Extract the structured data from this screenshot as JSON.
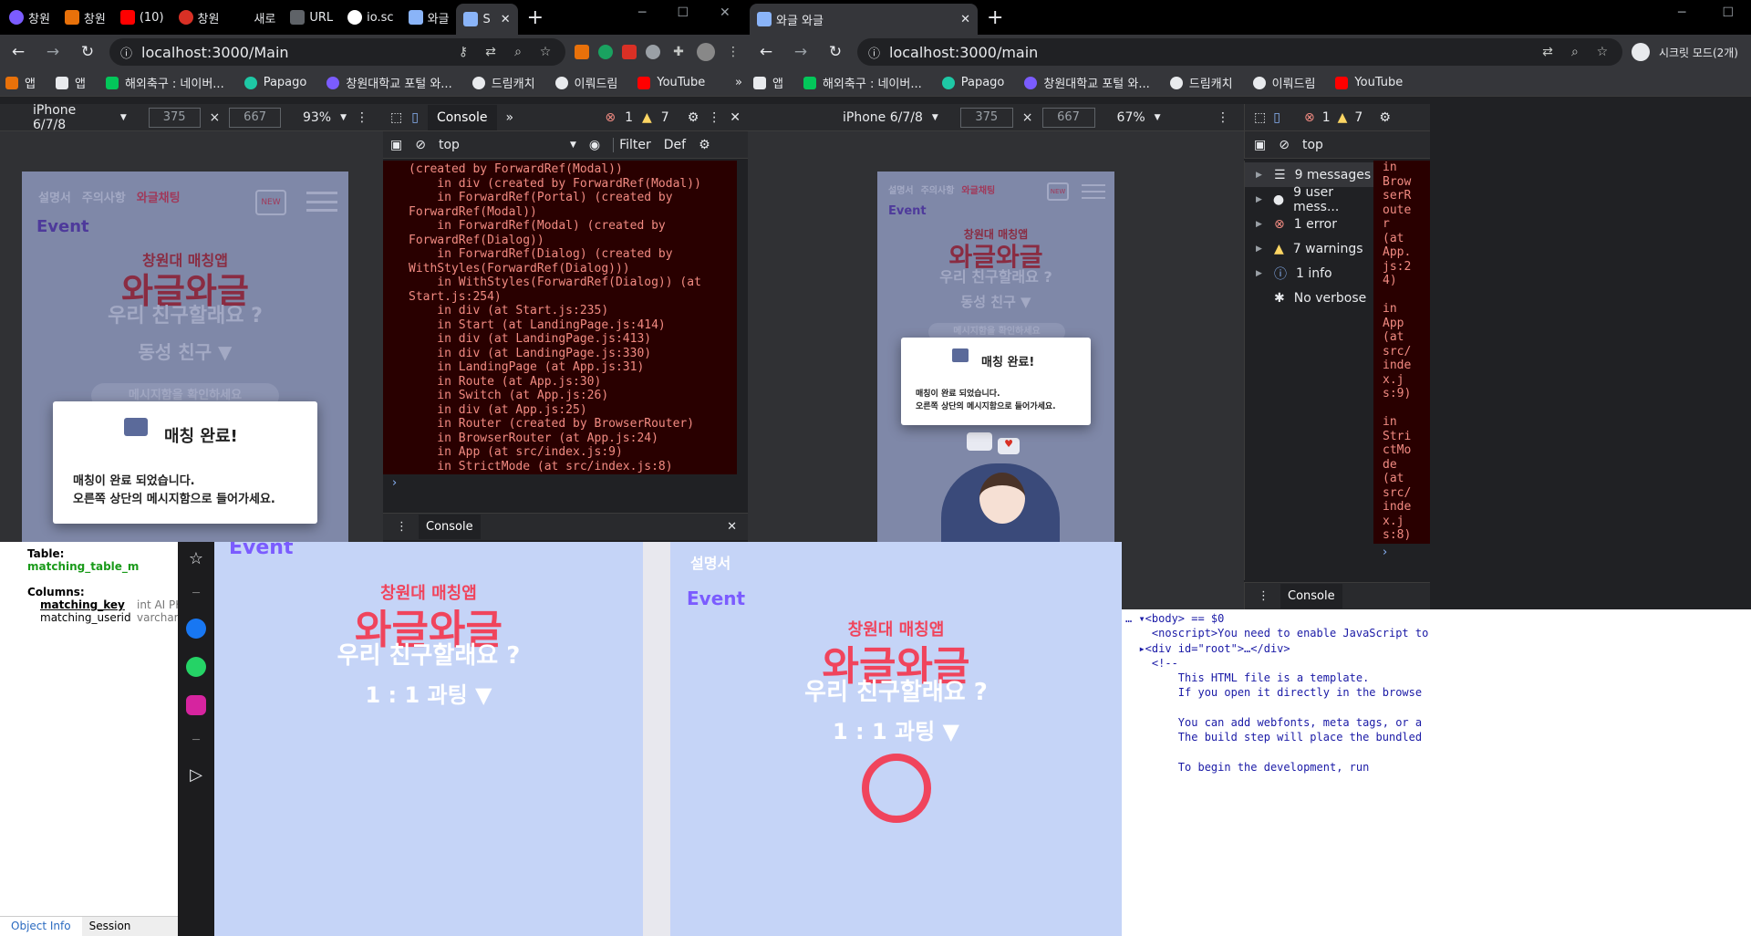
{
  "left_window": {
    "tabs": [
      {
        "label": "창원",
        "icon": "purple-w-icon"
      },
      {
        "label": "창원",
        "icon": "orange-book-icon"
      },
      {
        "label": "(10)",
        "icon": "youtube-icon"
      },
      {
        "label": "창원",
        "icon": "red-alarm-icon"
      },
      {
        "label": "새로",
        "icon": ""
      },
      {
        "label": "URL",
        "icon": "db-icon"
      },
      {
        "label": "io.sc",
        "icon": "google-icon"
      },
      {
        "label": "와글",
        "icon": "app-icon"
      },
      {
        "label": "S",
        "icon": "app-icon"
      }
    ],
    "url": "localhost:3000/Main",
    "bookmarks": [
      "앱",
      "앱",
      "해외축구 : 네이버...",
      "Papago",
      "창원대학교 포털 와...",
      "드림캐치",
      "이뤄드림",
      "YouTube"
    ],
    "device": "iPhone 6/7/8",
    "width": "375",
    "height": "667",
    "zoom": "93%",
    "devtools": {
      "tab": "Console",
      "errors": "1",
      "warnings": "7",
      "context": "top",
      "filter": "Filter",
      "level": "Def",
      "drawer_tab": "Console",
      "log_lines": [
        "(created by ForwardRef(Modal))",
        "    in div (created by ForwardRef(Modal))",
        "    in ForwardRef(Portal) (created by",
        "ForwardRef(Modal))",
        "    in ForwardRef(Modal) (created by",
        "ForwardRef(Dialog))",
        "    in ForwardRef(Dialog) (created by",
        "WithStyles(ForwardRef(Dialog)))",
        "    in WithStyles(ForwardRef(Dialog)) (at",
        "Start.js:254)",
        "    in div (at Start.js:235)",
        "    in Start (at LandingPage.js:414)",
        "    in div (at LandingPage.js:413)",
        "    in div (at LandingPage.js:330)",
        "    in LandingPage (at App.js:31)",
        "    in Route (at App.js:30)",
        "    in Switch (at App.js:26)",
        "    in div (at App.js:25)",
        "    in Router (created by BrowserRouter)",
        "    in BrowserRouter (at App.js:24)",
        "    in App (at src/index.js:9)",
        "    in StrictMode (at src/index.js:8)"
      ]
    },
    "phone": {
      "nav": [
        "설명서",
        "주의사항",
        "와글채팅"
      ],
      "new_badge": "NEW",
      "event": "Event",
      "subtitle": "창원대 매칭앱",
      "title": "와글와글",
      "tagline": "우리 친구할래요 ?",
      "option": "동성 친구 ▼",
      "faded": "메시지함을 확인하세요",
      "modal_title": "매칭 완료!",
      "modal_line1": "매칭이 완료 되었습니다.",
      "modal_line2": "오른쪽 상단의 메시지함으로 들어가세요."
    }
  },
  "right_window": {
    "tab_title": "와글 와글",
    "url": "localhost:3000/main",
    "incognito": "시크릿 모드(2개)",
    "bookmarks": [
      "앱",
      "해외축구 : 네이버...",
      "Papago",
      "창원대학교 포털 와...",
      "드림캐치",
      "이뤄드림",
      "YouTube"
    ],
    "device": "iPhone 6/7/8",
    "width": "375",
    "height": "667",
    "zoom": "67%",
    "errors": "1",
    "warnings": "7",
    "context": "top",
    "sidebar": [
      {
        "label": "9 messages",
        "icon": "list-icon"
      },
      {
        "label": "9 user mess...",
        "icon": "user-icon"
      },
      {
        "label": "1 error",
        "icon": "error-icon"
      },
      {
        "label": "7 warnings",
        "icon": "warning-icon"
      },
      {
        "label": "1 info",
        "icon": "info-icon"
      },
      {
        "label": "No verbose",
        "icon": "bug-icon"
      }
    ],
    "log_lines": [
      "in",
      "Brow",
      "serR",
      "oute",
      "r",
      "(at",
      "App.",
      "js:2",
      "4)",
      "",
      "in",
      "App",
      "(at",
      "src/",
      "inde",
      "x.j",
      "s:9)",
      "",
      "in",
      "Stri",
      "ctMo",
      "de",
      "(at",
      "src/",
      "inde",
      "x.j",
      "s:8)"
    ],
    "drawer_tab": "Console",
    "phone": {
      "nav": [
        "설명서",
        "주의사항",
        "와글채팅"
      ],
      "new_badge": "NEW",
      "event": "Event",
      "subtitle": "창원대 매칭앱",
      "title": "와글와글",
      "tagline": "우리 친구할래요 ?",
      "option": "동성 친구 ▼",
      "faded": "메시지함을 확인하세요",
      "modal_title": "매칭 완료!",
      "modal_line1": "매칭이 완료 되었습니다.",
      "modal_line2": "오른쪽 상단의 메시지함으로 들어가세요."
    }
  },
  "db_panel": {
    "table_label": "Table:",
    "table_name": "matching_table_m",
    "columns_label": "Columns:",
    "columns": [
      {
        "name": "matching_key",
        "type": "int AI PK"
      },
      {
        "name": "matching_userid",
        "type": "varchar("
      }
    ],
    "tabs": [
      "Object Info",
      "Session"
    ]
  },
  "bottom_pages": {
    "page1": {
      "event": "Event",
      "subtitle": "창원대 매칭앱",
      "title": "와글와글",
      "tagline": "우리 친구할래요 ?",
      "option": "1 : 1 과팅 ▼"
    },
    "page2": {
      "nav": "설명서",
      "event": "Event",
      "subtitle": "창원대 매칭앱",
      "title": "와글와글",
      "tagline": "우리 친구할래요 ?",
      "option": "1 : 1 과팅 ▼"
    }
  },
  "elements_panel": {
    "lines": [
      "… ▾<body> == $0",
      "    <noscript>You need to enable JavaScript to",
      "  ▸<div id=\"root\">…</div>",
      "    <!--",
      "        This HTML file is a template.",
      "        If you open it directly in the browse",
      "",
      "        You can add webfonts, meta tags, or a",
      "        The build step will place the bundled",
      "",
      "        To begin the development, run"
    ]
  },
  "colors": {
    "accent_pink": "#f0445c",
    "accent_purple": "#7b5cff",
    "error_bg": "#290000"
  }
}
